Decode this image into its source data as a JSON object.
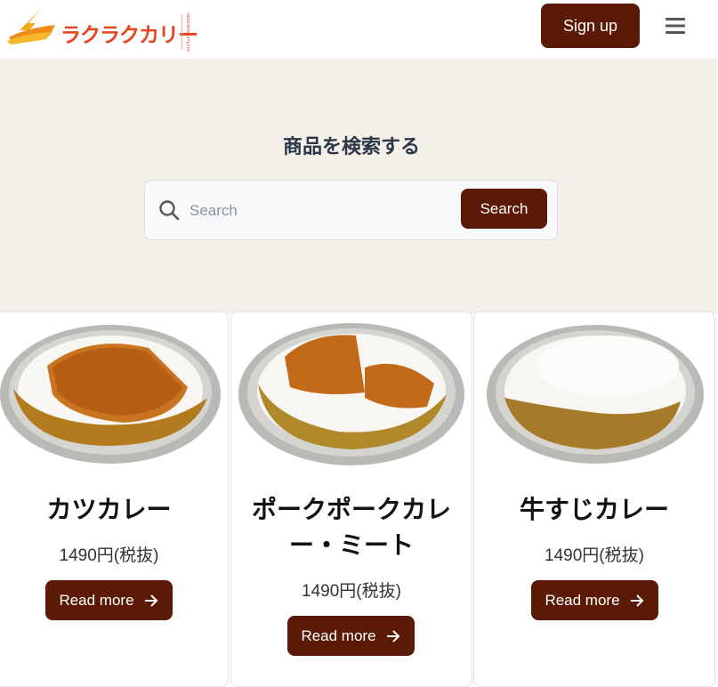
{
  "header": {
    "logo_text": "ラクラクカリー",
    "logo_sub": "rakurakucurry.com",
    "signup_label": "Sign up",
    "menu_icon": "hamburger-menu-icon"
  },
  "hero": {
    "title": "商品を検索する",
    "search": {
      "placeholder": "Search",
      "value": "",
      "button_label": "Search",
      "icon": "search-icon"
    }
  },
  "products": [
    {
      "name": "カツカレー",
      "price": "1490円(税抜)",
      "button_label": "Read more"
    },
    {
      "name": "ポークポークカレー・ミート",
      "price": "1490円(税抜)",
      "button_label": "Read more"
    },
    {
      "name": "牛すじカレー",
      "price": "1490円(税抜)",
      "button_label": "Read more"
    }
  ],
  "colors": {
    "brand_dark": "#5a1a06",
    "logo_orange": "#e8441c",
    "hero_bg": "#f3efe9"
  }
}
